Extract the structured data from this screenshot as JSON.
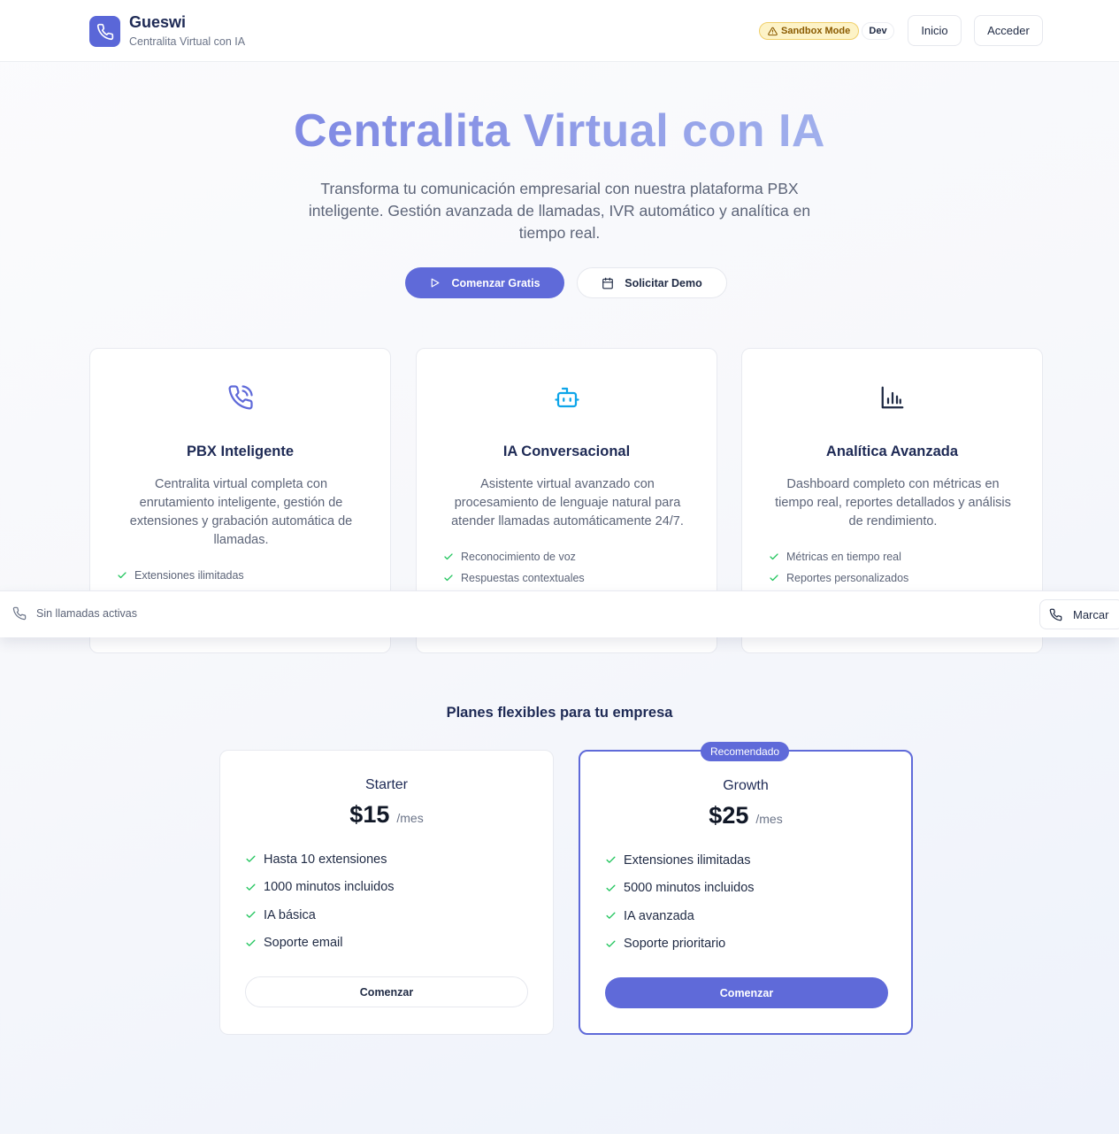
{
  "header": {
    "brand": "Gueswi",
    "subtitle": "Centralita Virtual con IA",
    "sandbox_label": "Sandbox Mode",
    "env_label": "Dev",
    "nav": {
      "home": "Inicio",
      "login": "Acceder"
    }
  },
  "hero": {
    "title": "Centralita Virtual con IA",
    "description": "Transforma tu comunicación empresarial con nuestra plataforma PBX inteligente. Gestión avanzada de llamadas, IVR automático y analítica en tiempo real.",
    "primary_cta": "Comenzar Gratis",
    "secondary_cta": "Solicitar Demo"
  },
  "features": [
    {
      "icon": "phone-call-icon",
      "icon_color": "#5f6ad9",
      "title": "PBX Inteligente",
      "description": "Centralita virtual completa con enrutamiento inteligente, gestión de extensiones y grabación automática de llamadas.",
      "items": [
        "Extensiones ilimitadas"
      ]
    },
    {
      "icon": "bot-icon",
      "icon_color": "#0ea5e9",
      "title": "IA Conversacional",
      "description": "Asistente virtual avanzado con procesamiento de lenguaje natural para atender llamadas automáticamente 24/7.",
      "items": [
        "Reconocimiento de voz",
        "Respuestas contextuales"
      ]
    },
    {
      "icon": "bar-chart-icon",
      "icon_color": "#1f2a44",
      "title": "Analítica Avanzada",
      "description": "Dashboard completo con métricas en tiempo real, reportes detallados y análisis de rendimiento.",
      "items": [
        "Métricas en tiempo real",
        "Reportes personalizados"
      ]
    }
  ],
  "callbar": {
    "status": "Sin llamadas activas",
    "dial_label": "Marcar"
  },
  "plans": {
    "title": "Planes flexibles para tu empresa",
    "items": [
      {
        "name": "Starter",
        "price": "$15",
        "period": "/mes",
        "features": [
          "Hasta 10 extensiones",
          "1000 minutos incluidos",
          "IA básica",
          "Soporte email"
        ],
        "cta": "Comenzar"
      },
      {
        "name": "Growth",
        "badge": "Recomendado",
        "price": "$25",
        "period": "/mes",
        "features": [
          "Extensiones ilimitadas",
          "5000 minutos incluidos",
          "IA avanzada",
          "Soporte prioritario"
        ],
        "cta": "Comenzar"
      }
    ]
  },
  "colors": {
    "accent": "#5f6ad9",
    "check": "#22c55e",
    "sandbox_bg": "#fdf3c7"
  }
}
